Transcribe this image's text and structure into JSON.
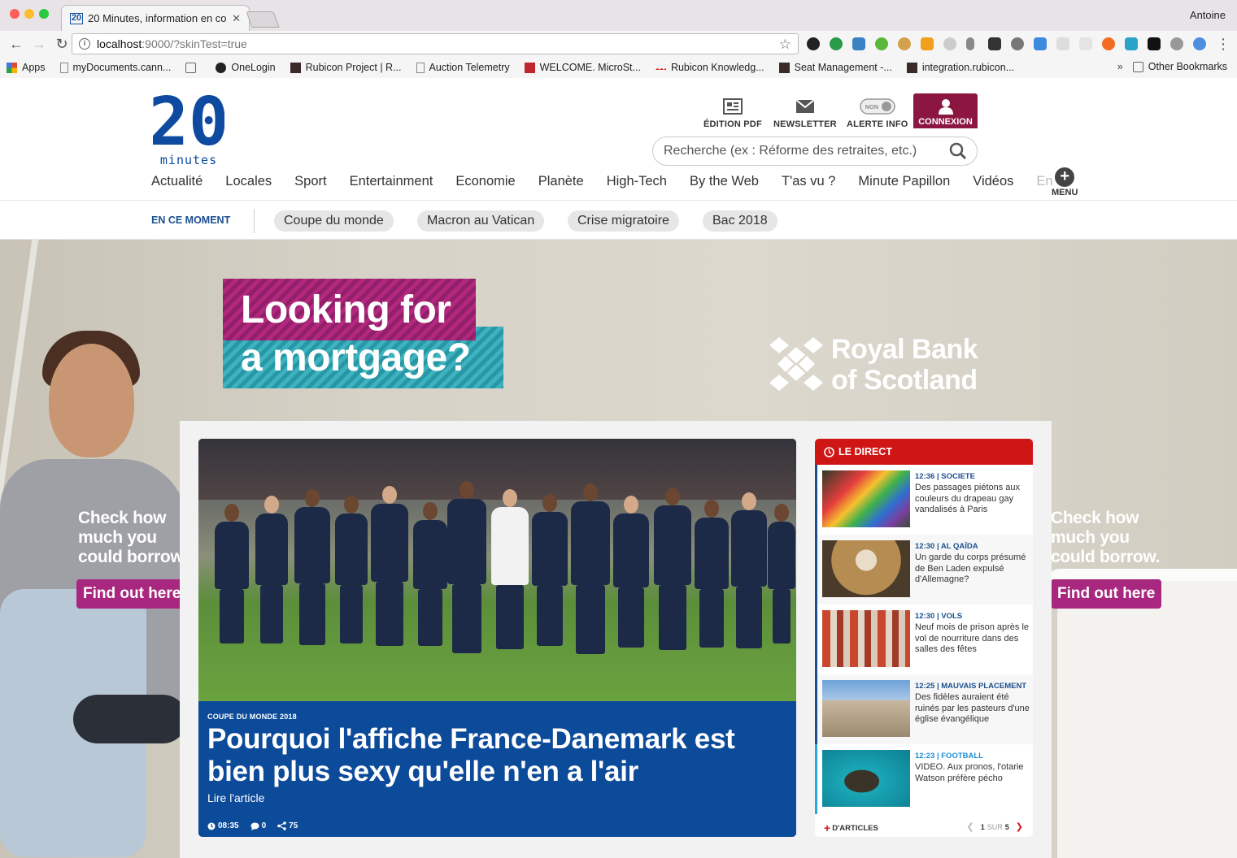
{
  "browser": {
    "tab_title": "20 Minutes, information en co",
    "tab_favicon": "20",
    "user_name": "Antoine",
    "url_host": "localhost",
    "url_path": ":9000/?skinTest=true",
    "bookmarks": [
      {
        "label": "Apps",
        "icon": "apps-grid-icon",
        "color": "#d94a3a"
      },
      {
        "label": "myDocuments.cann...",
        "icon": "page-icon",
        "color": "#888888"
      },
      {
        "label": "",
        "icon": "folder-icon",
        "color": "#666666"
      },
      {
        "label": "OneLogin",
        "icon": "onelogin-icon",
        "color": "#222222"
      },
      {
        "label": "Rubicon Project | R...",
        "icon": "rubicon-icon",
        "color": "#3a2a2a"
      },
      {
        "label": "Auction Telemetry",
        "icon": "page-icon",
        "color": "#888888"
      },
      {
        "label": "WELCOME. MicroSt...",
        "icon": "microstrategy-icon",
        "color": "#c0262d"
      },
      {
        "label": "Rubicon Knowledg...",
        "icon": "dots-icon",
        "color": "#d22"
      },
      {
        "label": "Seat Management -...",
        "icon": "rubicon-icon",
        "color": "#3a2a2a"
      },
      {
        "label": "integration.rubicon...",
        "icon": "rubicon-icon",
        "color": "#3a2a2a"
      }
    ],
    "other_bookmarks": "Other Bookmarks",
    "overflow": "»"
  },
  "site": {
    "header_buttons": [
      {
        "label": "ÉDITION PDF",
        "icon": "newspaper-icon"
      },
      {
        "label": "NEWSLETTER",
        "icon": "envelope-icon"
      },
      {
        "label": "ALERTE INFO",
        "icon": "toggle-icon",
        "toggle_text": "NON"
      }
    ],
    "connexion_label": "CONNEXION",
    "search_placeholder": "Recherche (ex : Réforme des retraites, etc.)",
    "nav": [
      "Actualité",
      "Locales",
      "Sport",
      "Entertainment",
      "Economie",
      "Planète",
      "High-Tech",
      "By the Web",
      "T'as vu ?",
      "Minute Papillon",
      "Vidéos",
      "En"
    ],
    "menu_label": "MENU",
    "menu_symbol": "+",
    "trending_label": "EN CE MOMENT",
    "trending": [
      "Coupe du monde",
      "Macron au Vatican",
      "Crise migratoire",
      "Bac 2018"
    ],
    "logo_number": "20",
    "logo_word": "minutes"
  },
  "ad": {
    "headline_line1": "Looking for",
    "headline_line2": "a mortgage?",
    "brand_line1": "Royal Bank",
    "brand_line2": "of Scotland",
    "side_copy_line1": "Check how",
    "side_copy_line2": "much you",
    "side_copy_line3": "could borrow.",
    "cta": "Find out here",
    "colors": {
      "magenta": "#a8277f",
      "teal": "#3eb3bf"
    }
  },
  "hero": {
    "category": "COUPE DU MONDE 2018",
    "title": "Pourquoi l'affiche France-Danemark est bien plus sexy qu'elle n'en a l'air",
    "read_more": "Lire l'article",
    "time": "08:35",
    "comments": "0",
    "shares": "75"
  },
  "direct": {
    "title": "LE DIRECT",
    "items": [
      {
        "time": "12:36",
        "tag": "SOCIETE",
        "text": "Des passages piétons aux couleurs du drapeau gay vandalisés à Paris",
        "thumb": "rainbow-umbrella-photo"
      },
      {
        "time": "12:30",
        "tag": "AL QAÏDA",
        "text": "Un garde du corps présumé de Ben Laden expulsé d'Allemagne?",
        "thumb": "portrait-photo"
      },
      {
        "time": "12:30",
        "tag": "VOLS",
        "text": "Neuf mois de prison après le vol de nourriture dans des salles des fêtes",
        "thumb": "food-items-photo"
      },
      {
        "time": "12:25",
        "tag": "MAUVAIS PLACEMENT",
        "text": "Des fidèles auraient été ruinés par les pasteurs d'une église évangélique",
        "thumb": "police-building-photo"
      },
      {
        "time": "12:23",
        "tag": "FOOTBALL",
        "text": "VIDEO. Aux pronos, l'otarie Watson préfère pécho",
        "thumb": "sea-lion-photo"
      }
    ],
    "more_label": "D'ARTICLES",
    "more_symbol": "+",
    "page_current": "1",
    "page_word": "SUR",
    "page_total": "5"
  }
}
